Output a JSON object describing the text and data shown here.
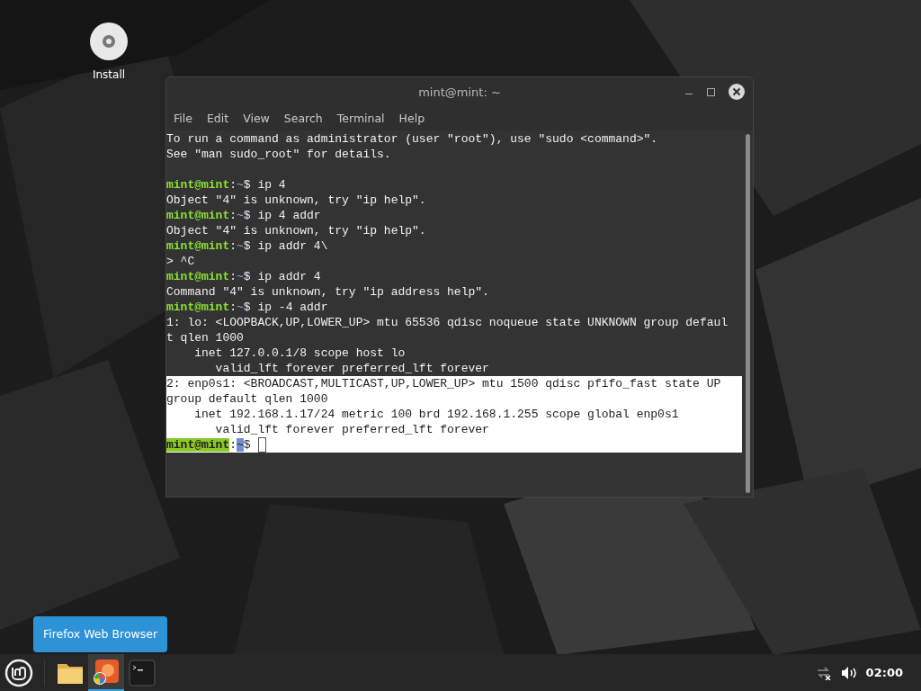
{
  "desktop_icons": [
    {
      "label": "Install"
    }
  ],
  "window": {
    "title": "mint@mint: ~",
    "menu": [
      "File",
      "Edit",
      "View",
      "Search",
      "Terminal",
      "Help"
    ],
    "lines": [
      {
        "kind": "output",
        "text": "To run a command as administrator (user \"root\"), use \"sudo <command>\".",
        "selected": false
      },
      {
        "kind": "output",
        "text": "See \"man sudo_root\" for details.",
        "selected": false
      },
      {
        "kind": "blank",
        "selected": false
      },
      {
        "kind": "prompt",
        "user": "mint@mint",
        "sep": ":",
        "path": "~",
        "symbol": "$",
        "command": "ip 4",
        "selected": false
      },
      {
        "kind": "output",
        "text": "Object \"4\" is unknown, try \"ip help\".",
        "selected": false
      },
      {
        "kind": "prompt",
        "user": "mint@mint",
        "sep": ":",
        "path": "~",
        "symbol": "$",
        "command": "ip 4 addr",
        "selected": false
      },
      {
        "kind": "output",
        "text": "Object \"4\" is unknown, try \"ip help\".",
        "selected": false
      },
      {
        "kind": "prompt",
        "user": "mint@mint",
        "sep": ":",
        "path": "~",
        "symbol": "$",
        "command": "ip addr 4\\",
        "selected": false
      },
      {
        "kind": "output",
        "text": "> ^C",
        "selected": false
      },
      {
        "kind": "prompt",
        "user": "mint@mint",
        "sep": ":",
        "path": "~",
        "symbol": "$",
        "command": "ip addr 4",
        "selected": false
      },
      {
        "kind": "output",
        "text": "Command \"4\" is unknown, try \"ip address help\".",
        "selected": false
      },
      {
        "kind": "prompt",
        "user": "mint@mint",
        "sep": ":",
        "path": "~",
        "symbol": "$",
        "command": "ip -4 addr",
        "selected": false
      },
      {
        "kind": "output",
        "text": "1: lo: <LOOPBACK,UP,LOWER_UP> mtu 65536 qdisc noqueue state UNKNOWN group defaul",
        "selected": false
      },
      {
        "kind": "output",
        "text": "t qlen 1000",
        "selected": false
      },
      {
        "kind": "output",
        "text": "    inet 127.0.0.1/8 scope host lo",
        "selected": false
      },
      {
        "kind": "output",
        "text": "       valid_lft forever preferred_lft forever",
        "selected": false
      },
      {
        "kind": "output",
        "text": "2: enp0s1: <BROADCAST,MULTICAST,UP,LOWER_UP> mtu 1500 qdisc pfifo_fast state UP",
        "selected": true
      },
      {
        "kind": "output",
        "text": "group default qlen 1000",
        "selected": true
      },
      {
        "kind": "output",
        "text": "    inet 192.168.1.17/24 metric 100 brd 192.168.1.255 scope global enp0s1",
        "selected": true
      },
      {
        "kind": "output",
        "text": "       valid_lft forever preferred_lft forever",
        "selected": true
      },
      {
        "kind": "prompt",
        "user": "mint@mint",
        "sep": ":",
        "path": "~",
        "symbol": "$",
        "selected": true,
        "cursor": true
      }
    ]
  },
  "tooltip": "Firefox Web Browser",
  "taskbar": {
    "apps": [
      {
        "kind": "files",
        "selected": false
      },
      {
        "kind": "firefox",
        "selected": true
      },
      {
        "kind": "terminal",
        "selected": false
      }
    ],
    "clock": "02:00"
  }
}
